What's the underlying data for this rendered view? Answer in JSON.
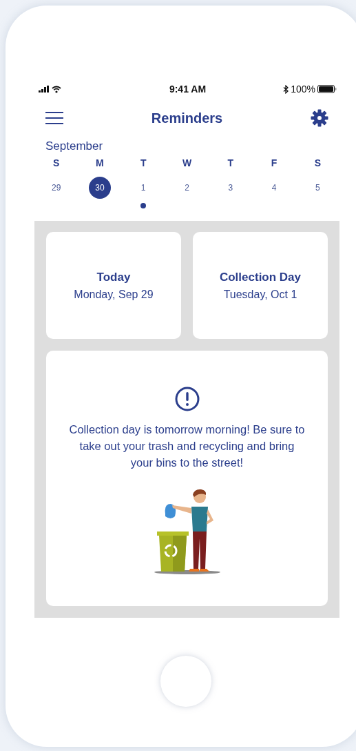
{
  "status_bar": {
    "time": "9:41 AM",
    "battery": "100%"
  },
  "header": {
    "title": "Reminders"
  },
  "calendar": {
    "month": "September",
    "weekdays": [
      "S",
      "M",
      "T",
      "W",
      "T",
      "F",
      "S"
    ],
    "days": [
      {
        "label": "29",
        "selected": false,
        "has_event": false
      },
      {
        "label": "30",
        "selected": true,
        "has_event": false
      },
      {
        "label": "1",
        "selected": false,
        "has_event": true
      },
      {
        "label": "2",
        "selected": false,
        "has_event": false
      },
      {
        "label": "3",
        "selected": false,
        "has_event": false
      },
      {
        "label": "4",
        "selected": false,
        "has_event": false
      },
      {
        "label": "5",
        "selected": false,
        "has_event": false
      }
    ]
  },
  "cards": [
    {
      "title": "Today",
      "date": "Monday, Sep 29"
    },
    {
      "title": "Collection Day",
      "date": "Tuesday, Oct 1"
    }
  ],
  "notice": {
    "message": "Collection day is tomorrow morning! Be sure to take out your trash and recycling and bring your bins to the street!"
  }
}
